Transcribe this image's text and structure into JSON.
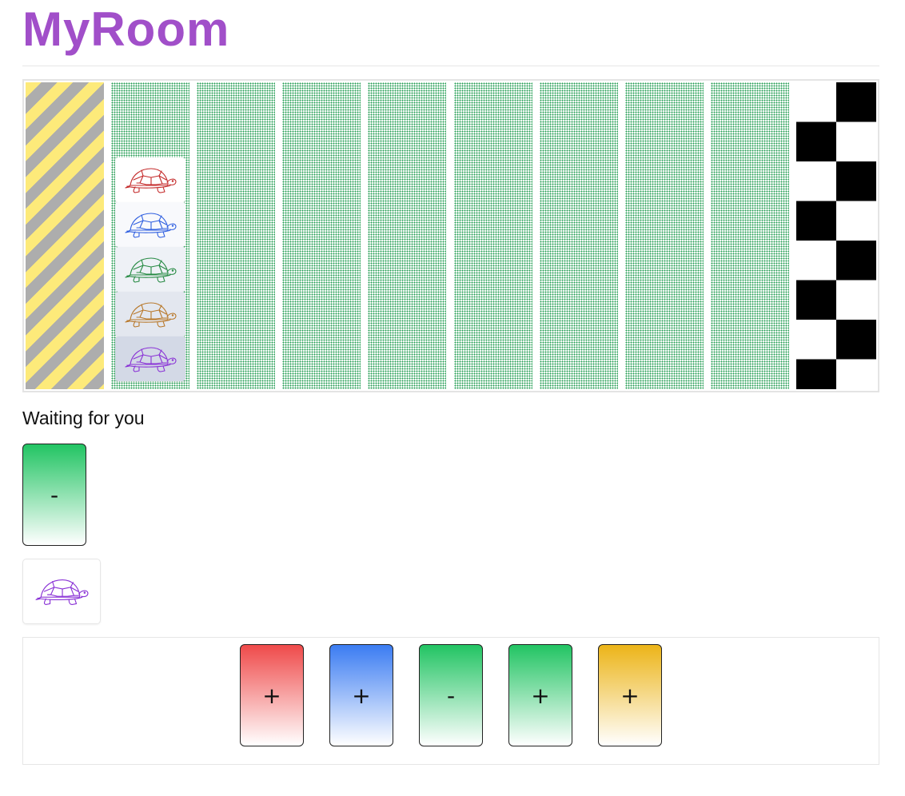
{
  "app": {
    "title": "MyRoom"
  },
  "board": {
    "lanes": [
      "start",
      "track",
      "track",
      "track",
      "track",
      "track",
      "track",
      "track",
      "track",
      "finish"
    ],
    "stack": [
      {
        "turtle": "red-turtle-icon",
        "color": "#c42a2a"
      },
      {
        "turtle": "blue-turtle-icon",
        "color": "#2f5fe0"
      },
      {
        "turtle": "green-turtle-icon",
        "color": "#268a43"
      },
      {
        "turtle": "orange-turtle-icon",
        "color": "#b8782a"
      },
      {
        "turtle": "purple-turtle-icon",
        "color": "#8a33d6"
      }
    ]
  },
  "status": {
    "text": "Waiting for you"
  },
  "played_card": {
    "symbol": "-",
    "color": "green"
  },
  "my_turtle": {
    "icon": "purple-turtle-icon",
    "color": "#8a33d6"
  },
  "hand": {
    "cards": [
      {
        "symbol": "+",
        "color": "red"
      },
      {
        "symbol": "+",
        "color": "blue"
      },
      {
        "symbol": "-",
        "color": "green"
      },
      {
        "symbol": "+",
        "color": "green"
      },
      {
        "symbol": "+",
        "color": "yellow"
      }
    ]
  }
}
